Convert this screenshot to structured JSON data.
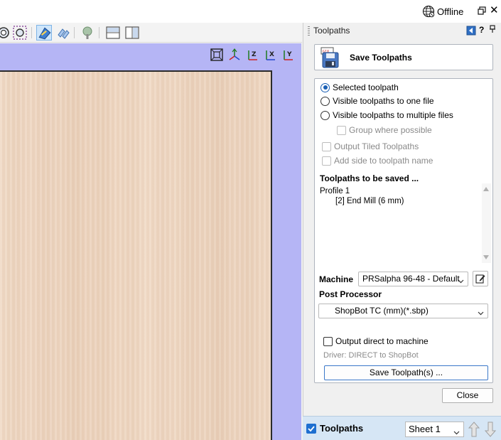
{
  "titlebar": {
    "status": "Offline",
    "restore_glyph": "🗗",
    "close_glyph": "✕"
  },
  "toolbar": {
    "icons": [
      "zoom-circle-icon",
      "zoom-dotted-icon",
      "edit-toolpath-icon",
      "link-toolpath-icon",
      "tree-icon",
      "layout-horizontal-icon",
      "layout-vertical-icon"
    ],
    "active_icon": "edit-toolpath-icon"
  },
  "view_controls": {
    "labels": [
      "Z",
      "Z",
      "X",
      "Y"
    ]
  },
  "panel": {
    "title": "Toolpaths",
    "help_glyph": "?",
    "pin_glyph": "🖈",
    "save_title": "Save Toolpaths",
    "radios": {
      "selected": "Selected toolpath",
      "one_file": "Visible toolpaths to one file",
      "multiple_files": "Visible toolpaths to multiple files"
    },
    "checks": {
      "group": "Group where possible",
      "tiled": "Output Tiled Toolpaths",
      "add_side": "Add side to toolpath name"
    },
    "list_heading": "Toolpaths to be saved ...",
    "list_items": [
      "Profile 1",
      "[2] End Mill (6 mm)"
    ],
    "machine_label": "Machine",
    "machine_value": "PRSalpha 96-48 - Default",
    "post_label": "Post Processor",
    "post_value": "ShopBot TC (mm)(*.sbp)",
    "output_direct": "Output direct to machine",
    "driver": "Driver: DIRECT to ShopBot",
    "save_button": "Save Toolpath(s) ...",
    "close_button": "Close"
  },
  "bottom": {
    "tab_label": "Toolpaths",
    "sheet": "Sheet 1"
  },
  "colors": {
    "accent": "#1a5fb4",
    "viewport_bg": "#b5b5f5",
    "board": "#eed6c1",
    "bottom_bar": "#d6e6f5"
  }
}
